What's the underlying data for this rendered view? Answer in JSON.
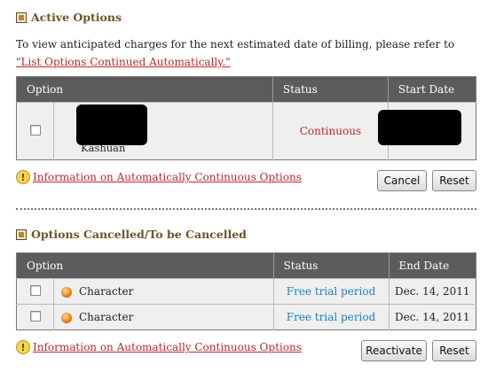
{
  "active": {
    "title": "Active Options",
    "description_prefix": "To view anticipated charges for the next estimated date of billing, please refer to ",
    "description_link": "\"List Options Continued Automatically.\"",
    "columns": [
      "Option",
      "Status",
      "Start Date"
    ],
    "rows": [
      {
        "option_name": "Kashuan",
        "status": "Continuous"
      }
    ],
    "info_link": "Information on Automatically Continuous Options",
    "buttons": {
      "cancel": "Cancel",
      "reset": "Reset"
    }
  },
  "cancelled": {
    "title": "Options Cancelled/To be Cancelled",
    "columns": [
      "Option",
      "Status",
      "End Date"
    ],
    "rows": [
      {
        "option_name": "Character",
        "status": "Free trial period",
        "end_date": "Dec. 14, 2011"
      },
      {
        "option_name": "Character",
        "status": "Free trial period",
        "end_date": "Dec. 14, 2011"
      }
    ],
    "info_link": "Information on Automatically Continuous Options",
    "buttons": {
      "reactivate": "Reactivate",
      "reset": "Reset"
    }
  },
  "icons": {
    "section": "section-square-icon",
    "info": "exclamation-info-icon",
    "option": "orange-ball-icon"
  },
  "colors": {
    "section_title": "#6b5526",
    "link": "#c0272d",
    "header_bg": "#5c5c5c",
    "status_continuous": "#c0272d",
    "status_trial": "#1d7fbf"
  }
}
